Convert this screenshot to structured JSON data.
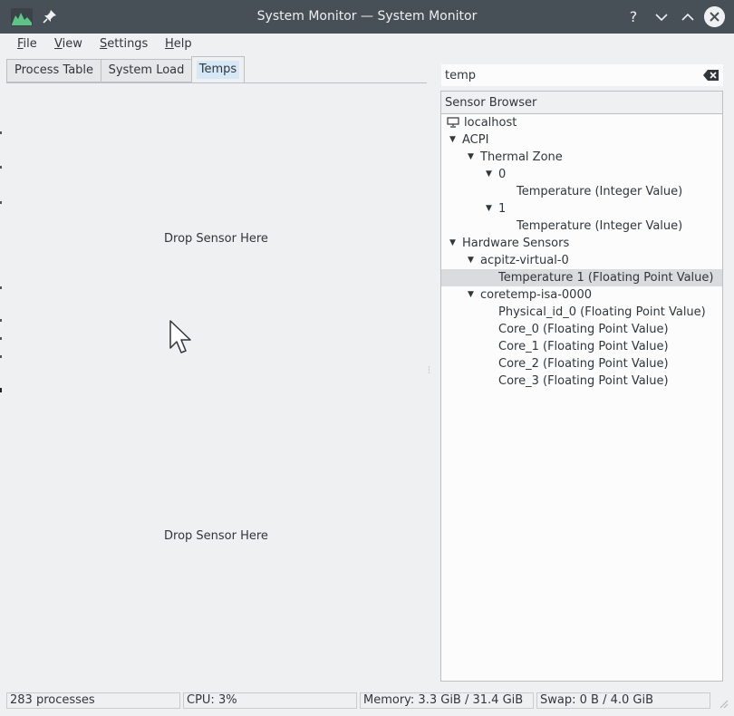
{
  "window": {
    "title": "System Monitor — System Monitor",
    "buttons": {
      "help": "?",
      "minimize": "⌄",
      "maximize": "⌃"
    }
  },
  "menu": [
    "File",
    "View",
    "Settings",
    "Help"
  ],
  "tabs": [
    {
      "label": "Process Table",
      "active": false
    },
    {
      "label": "System Load",
      "active": false
    },
    {
      "label": "Temps",
      "active": true
    }
  ],
  "workspace": {
    "drop_label_top": "Drop Sensor Here",
    "drop_label_bottom": "Drop Sensor Here"
  },
  "search": {
    "value": "temp"
  },
  "sensor_browser": {
    "header": "Sensor Browser",
    "items": [
      {
        "label": "localhost"
      },
      {
        "label": "ACPI"
      },
      {
        "label": "Thermal Zone"
      },
      {
        "label": "0"
      },
      {
        "label": "Temperature (Integer Value)"
      },
      {
        "label": "1"
      },
      {
        "label": "Temperature (Integer Value)"
      },
      {
        "label": "Hardware Sensors"
      },
      {
        "label": "acpitz-virtual-0"
      },
      {
        "label": "Temperature 1 (Floating Point Value)",
        "selected": true
      },
      {
        "label": "coretemp-isa-0000"
      },
      {
        "label": "Physical_id_0 (Floating Point Value)"
      },
      {
        "label": "Core_0 (Floating Point Value)"
      },
      {
        "label": "Core_1 (Floating Point Value)"
      },
      {
        "label": "Core_2 (Floating Point Value)"
      },
      {
        "label": "Core_3 (Floating Point Value)"
      }
    ]
  },
  "status": {
    "processes": "283 processes",
    "cpu": "CPU: 3%",
    "memory": "Memory: 3.3 GiB / 31.4 GiB",
    "swap": "Swap: 0 B / 4.0 GiB"
  },
  "colors": {
    "titlebar": "#475057",
    "window_bg": "#eff0f1",
    "selection": "#dadbdc",
    "active_tab_highlight": "#d6e8f6"
  }
}
